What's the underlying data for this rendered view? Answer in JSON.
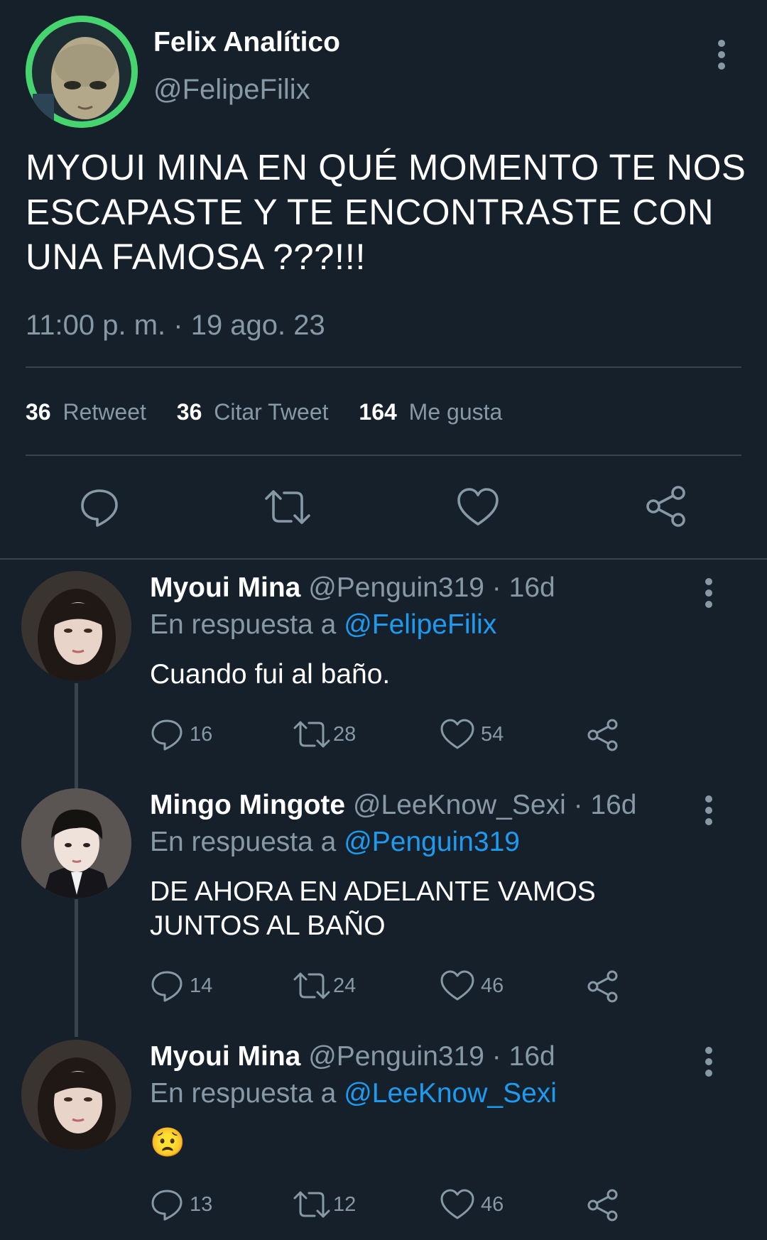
{
  "main_tweet": {
    "display_name": "Felix Analítico",
    "handle": "@FelipeFilix",
    "text_lines": [
      "MYOUI MINA EN QUÉ MOMENTO TE NOS",
      "ESCAPASTE Y TE ENCONTRASTE CON",
      "UNA FAMOSA ???!!!"
    ],
    "timestamp": "11:00 p. m. · 19 ago. 23",
    "stats": {
      "retweets_count": "36",
      "retweets_label": "Retweet",
      "quotes_count": "36",
      "quotes_label": "Citar Tweet",
      "likes_count": "164",
      "likes_label": "Me gusta"
    }
  },
  "replies": [
    {
      "display_name": "Myoui Mina",
      "handle_time": "@Penguin319 · 16d",
      "reply_prefix": "En respuesta a",
      "reply_to": "@FelipeFilix",
      "text_lines": [
        "Cuando fui al baño."
      ],
      "reply_count": "16",
      "retweet_count": "28",
      "like_count": "54"
    },
    {
      "display_name": "Mingo Mingote",
      "handle_time": "@LeeKnow_Sexi · 16d",
      "reply_prefix": "En respuesta a",
      "reply_to": "@Penguin319",
      "text_lines": [
        "DE AHORA EN ADELANTE VAMOS",
        "JUNTOS AL BAÑO"
      ],
      "reply_count": "14",
      "retweet_count": "24",
      "like_count": "46"
    },
    {
      "display_name": "Myoui Mina",
      "handle_time": "@Penguin319 · 16d",
      "reply_prefix": "En respuesta a",
      "reply_to": "@LeeKnow_Sexi",
      "text_lines": [
        "😟"
      ],
      "reply_count": "13",
      "retweet_count": "12",
      "like_count": "46"
    }
  ],
  "icons": {
    "more": "more-vertical-icon",
    "reply": "comment-icon",
    "retweet": "retweet-icon",
    "like": "heart-icon",
    "share": "share-icon"
  },
  "colors": {
    "background": "#15202b",
    "text": "#ffffff",
    "muted": "#8899a6",
    "link": "#1d9bf0",
    "divider": "#38444d"
  }
}
